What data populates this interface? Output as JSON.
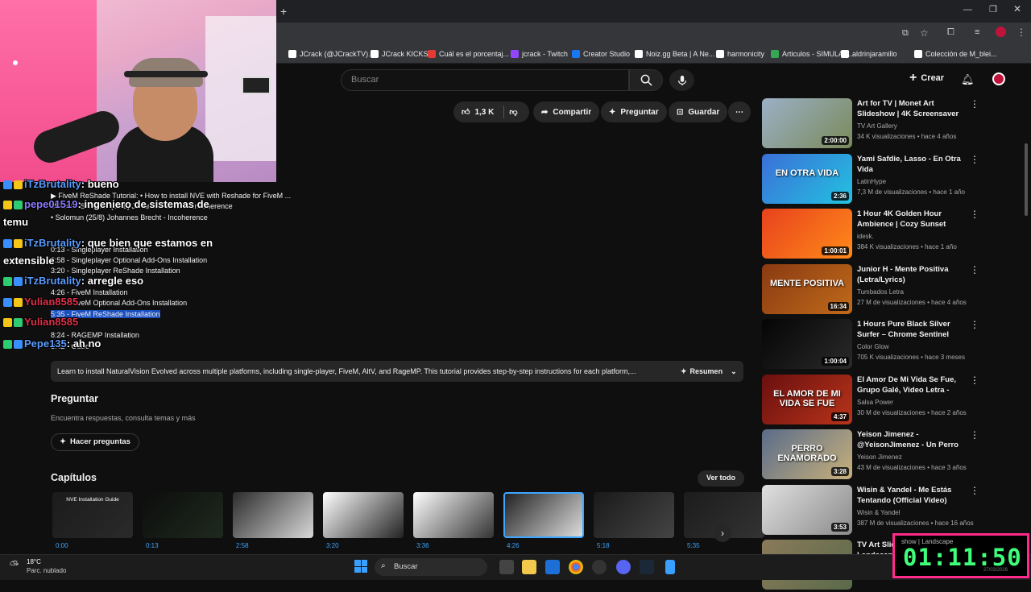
{
  "browser": {
    "tabs_new": "+",
    "bookmarks": [
      {
        "label": "JCrack (@JCrackTV)...",
        "color": "#ffffff"
      },
      {
        "label": "JCrack KICKS",
        "color": "#ffffff"
      },
      {
        "label": "Cuál es el porcentaj...",
        "color": "#e53935"
      },
      {
        "label": "jcrack - Twitch",
        "color": "#9146ff"
      },
      {
        "label": "Creator Studio",
        "color": "#1877f2"
      },
      {
        "label": "Noiz.gg Beta | A Ne...",
        "color": "#ffffff"
      },
      {
        "label": "harmonicity",
        "color": "#ffffff"
      },
      {
        "label": "Articulos - SIMULAC...",
        "color": "#34a853"
      },
      {
        "label": "aldrinjaramillo",
        "color": "#ffffff"
      },
      {
        "label": "Colección de M_blei...",
        "color": "#ffffff"
      }
    ]
  },
  "youtube": {
    "search_placeholder": "Buscar",
    "create_label": "Crear",
    "actions": {
      "likes": "1,3 K",
      "share": "Compartir",
      "ask": "Preguntar",
      "save": "Guardar"
    },
    "description": "Learn to install NaturalVision Evolved across multiple platforms, including single-player, FiveM, AltV, and RageMP. This tutorial provides step-by-step instructions for each platform,...",
    "summary_label": "Resumen",
    "ask_section": {
      "title": "Preguntar",
      "subtitle": "Encuentra respuestas, consulta temas y más",
      "button": "Hacer preguntas"
    },
    "chapters": {
      "title": "Capítulos",
      "view_all": "Ver todo",
      "first_thumb_text": "NVE Installation Guide",
      "times": [
        "0:00",
        "0:13",
        "2:58",
        "3:20",
        "3:36",
        "4:26",
        "5:18",
        "5:35"
      ]
    },
    "timestamps_overlay": [
      "▶ FiveM ReShade Tutorial: • How to install NVE with Reshade for FiveM ...",
      "Música · Solomun (25/8) Johannes Brecht - Incoherence",
      "• Solomun (25/8) Johannes Brecht - Incoherence",
      "0:13 - Singleplayer Installation",
      "2:58 - Singleplayer Optional Add-Ons Installation",
      "3:20 - Singleplayer ReShade Installation",
      "4:26 - FiveM Installation",
      "5:18 - FiveM Optional Add-Ons Installation",
      "5:35 - FiveM ReShade Installation",
      "8:24 - RAGEMP Installation",
      "8:42 - Outro"
    ],
    "recommendations": [
      {
        "title": "Art for TV | Monet Art Slideshow | 4K Screensaver fo...",
        "channel": "TV Art Gallery",
        "meta": "34 K visualizaciones • hace 4 años",
        "duration": "2:00:00",
        "c1": "#9bb0c6",
        "c2": "#7a8a5a"
      },
      {
        "title": "Yami Safdie, Lasso - En Otra Vida",
        "channel": "LatinHype",
        "meta": "7,3 M de visualizaciones • hace 1 año",
        "duration": "2:36",
        "thumb_text": "EN OTRA VIDA",
        "c1": "#3b6fd8",
        "c2": "#23c2e0"
      },
      {
        "title": "1 Hour 4K Golden Hour Ambience | Cozy Sunset Lamp...",
        "channel": "idesk.",
        "meta": "384 K visualizaciones • hace 1 año",
        "duration": "1:00:01",
        "c1": "#e8421c",
        "c2": "#ff8a1a"
      },
      {
        "title": "Junior H - Mente Positiva (Letra/Lyrics)",
        "channel": "Tumbados Letra",
        "meta": "27 M de visualizaciones • hace 4 años",
        "duration": "16:34",
        "thumb_text": "MENTE POSITIVA",
        "c1": "#8a3a12",
        "c2": "#c06a1a"
      },
      {
        "title": "1 Hours Pure Black Silver Surfer – Chrome Sentinel Live ...",
        "channel": "Color Glow",
        "meta": "705 K visualizaciones • hace 3 meses",
        "duration": "1:00:04",
        "c1": "#050505",
        "c2": "#2a2a2a"
      },
      {
        "title": "El Amor De Mi Vida Se Fue, Grupo Galé, Video Letra - Sals...",
        "channel": "Salsa Power",
        "meta": "30 M de visualizaciones • hace 2 años",
        "duration": "4:37",
        "thumb_text": "EL AMOR DE MI VIDA SE FUE",
        "c1": "#6a0f0f",
        "c2": "#b8341a"
      },
      {
        "title": "Yeison Jimenez - @YeisonJimenez - Un Perro ...",
        "channel": "Yeison Jimenez",
        "meta": "43 M de visualizaciones • hace 3 años",
        "duration": "3:28",
        "thumb_text": "PERRO ENAMORADO",
        "c1": "#5a6c8a",
        "c2": "#c8b07a"
      },
      {
        "title": "Wisin & Yandel - Me Estás Tentando (Official Video)",
        "channel": "Wisin & Yandel",
        "meta": "387 M de visualizaciones • hace 16 años",
        "duration": "3:53",
        "c1": "#e0e0e0",
        "c2": "#8a8a8a"
      },
      {
        "title": "TV Art Slideshow | Landscape Paintings ...",
        "channel": "",
        "meta": "",
        "duration": "",
        "c1": "#8a7a5a",
        "c2": "#5a6a4a"
      }
    ]
  },
  "stream_chat": [
    {
      "user": "iTzBrutality",
      "msg": ": bueno",
      "color": "#5a9bff"
    },
    {
      "user": "pepe01519",
      "msg": ": ingeniero de sistemas de",
      "color": "#8a7aff"
    },
    {
      "user": "",
      "msg": "temu",
      "color": "#ffffff"
    },
    {
      "user": "iTzBrutality",
      "msg": ": que bien que estamos en",
      "color": "#5a9bff"
    },
    {
      "user": "",
      "msg": "extensible",
      "color": "#ffffff"
    },
    {
      "user": "iTzBrutality",
      "msg": ": arregle eso",
      "color": "#5a9bff"
    },
    {
      "user": "Yulian8585",
      "msg": "",
      "color": "#e0304a"
    },
    {
      "user": "Yulian8585",
      "msg": "",
      "color": "#e0304a"
    },
    {
      "user": "Pepe135",
      "msg": ": ah no",
      "color": "#5a9bff"
    }
  ],
  "taskbar": {
    "weather_temp": "18°C",
    "weather_desc": "Parc. nublado",
    "search": "Buscar"
  },
  "overlay_clock": {
    "time": "01:11:50",
    "label": "show | Landscape",
    "date": "27/03/2026"
  }
}
